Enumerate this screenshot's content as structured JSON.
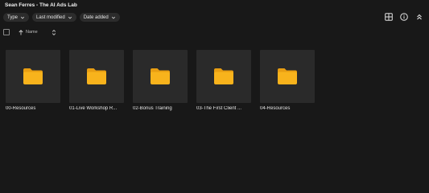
{
  "header": {
    "title": "Sean Ferres - The AI Ads Lab"
  },
  "filters": [
    {
      "label": "Type"
    },
    {
      "label": "Last modified"
    },
    {
      "label": "Date added"
    }
  ],
  "toolbar_icons": [
    "grid-view-icon",
    "info-icon",
    "collapse-icon"
  ],
  "list_header": {
    "name_label": "Name"
  },
  "folders": [
    {
      "label": "00-Resources"
    },
    {
      "label": "01-Live Workshop R..."
    },
    {
      "label": "02-Bonus Training"
    },
    {
      "label": "03-The First Client ..."
    },
    {
      "label": "04-Resources"
    }
  ],
  "colors": {
    "background": "#181818",
    "tile": "#2a2a2a",
    "folder": "#f8b31c",
    "folder_tab": "#e89e12"
  }
}
